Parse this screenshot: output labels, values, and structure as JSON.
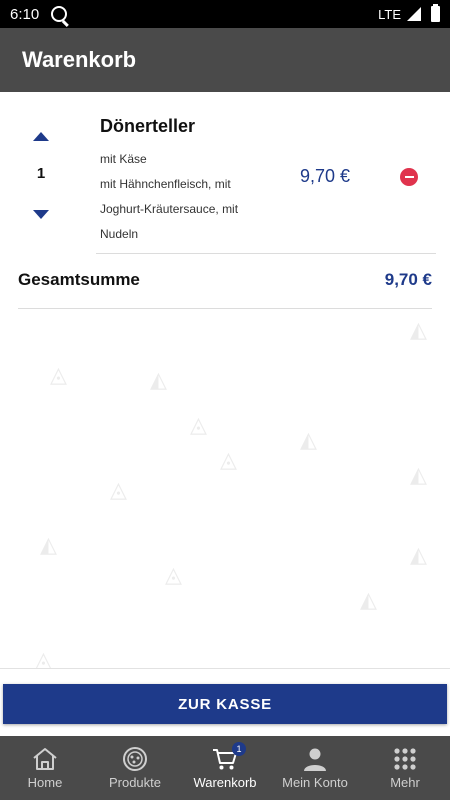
{
  "status_bar": {
    "time": "6:10",
    "network": "LTE"
  },
  "app_bar": {
    "title": "Warenkorb"
  },
  "cart": {
    "items": [
      {
        "quantity": "1",
        "name": "Dönerteller",
        "options": [
          "mit Käse",
          "mit Hähnchenfleisch, mit",
          "Joghurt-Kräutersauce, mit",
          "Nudeln"
        ],
        "price": "9,70 €"
      }
    ],
    "total_label": "Gesamtsumme",
    "total_value": "9,70 €"
  },
  "checkout": {
    "label": "ZUR KASSE"
  },
  "bottom_nav": {
    "items": [
      {
        "label": "Home",
        "icon": "home-icon"
      },
      {
        "label": "Produkte",
        "icon": "pizza-icon"
      },
      {
        "label": "Warenkorb",
        "icon": "cart-icon",
        "badge": "1",
        "active": true
      },
      {
        "label": "Mein Konto",
        "icon": "person-icon"
      },
      {
        "label": "Mehr",
        "icon": "grid-icon"
      }
    ]
  },
  "colors": {
    "accent": "#1e3a8a",
    "toolbar": "#4a4a4a",
    "remove": "#e0334d"
  }
}
